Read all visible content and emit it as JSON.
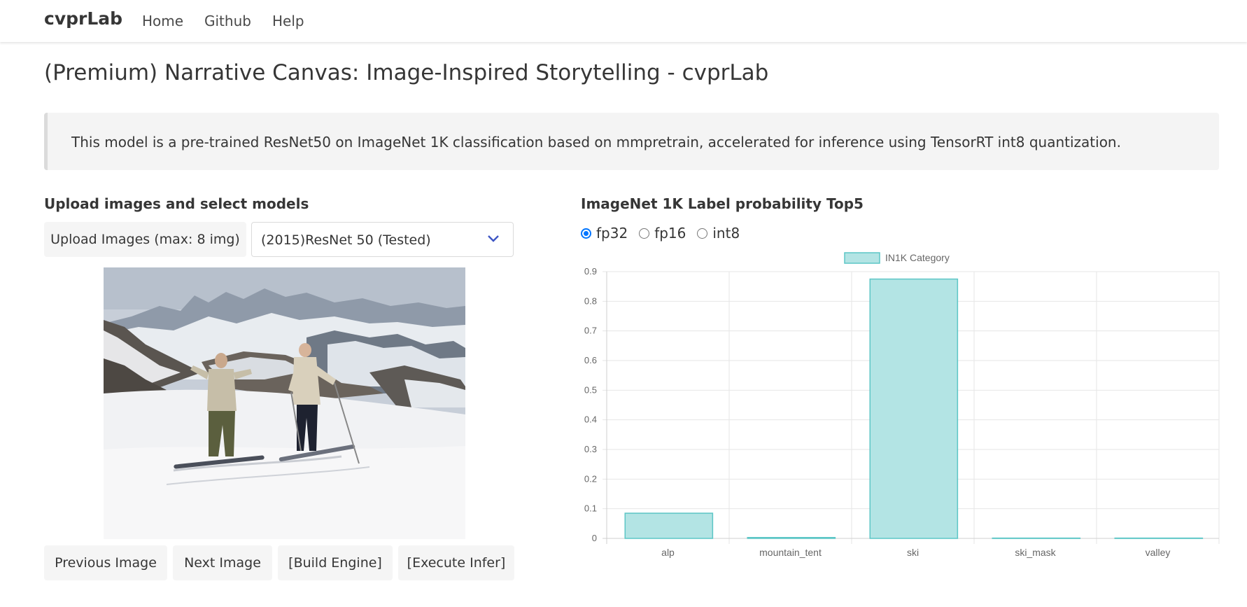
{
  "navbar": {
    "brand": "cvprLab",
    "links": [
      "Home",
      "Github",
      "Help"
    ]
  },
  "page": {
    "title": "(Premium) Narrative Canvas: Image-Inspired Storytelling - cvprLab",
    "description": "This model is a pre-trained ResNet50 on ImageNet 1K classification based on mmpretrain, accelerated for inference using TensorRT int8 quantization."
  },
  "left_panel": {
    "title": "Upload images and select models",
    "upload_label": "Upload Images (max: 8 img)",
    "model_select": {
      "value": "(2015)ResNet 50 (Tested)"
    },
    "buttons": {
      "prev": "Previous Image",
      "next": "Next Image",
      "build": "[Build Engine]",
      "infer": "[Execute Infer]"
    }
  },
  "right_panel": {
    "title": "ImageNet 1K Label probability Top5",
    "precision_options": [
      "fp32",
      "fp16",
      "int8"
    ],
    "selected_precision": "fp32"
  },
  "chart_data": {
    "type": "bar",
    "categories": [
      "alp",
      "mountain_tent",
      "ski",
      "ski_mask",
      "valley"
    ],
    "series": [
      {
        "name": "IN1K Category",
        "values": [
          0.085,
          0.003,
          0.875,
          0.001,
          0.001
        ]
      }
    ],
    "ylim": [
      0,
      0.9
    ],
    "yticks": [
      "0",
      "0.1",
      "0.2",
      "0.3",
      "0.4",
      "0.5",
      "0.6",
      "0.7",
      "0.8",
      "0.9"
    ],
    "grid": true,
    "legend_position": "top-center",
    "colors": {
      "fill": "#b3e4e4",
      "stroke": "#5cc6c6",
      "grid": "#e6e6e6",
      "tick_text": "#666666"
    }
  }
}
